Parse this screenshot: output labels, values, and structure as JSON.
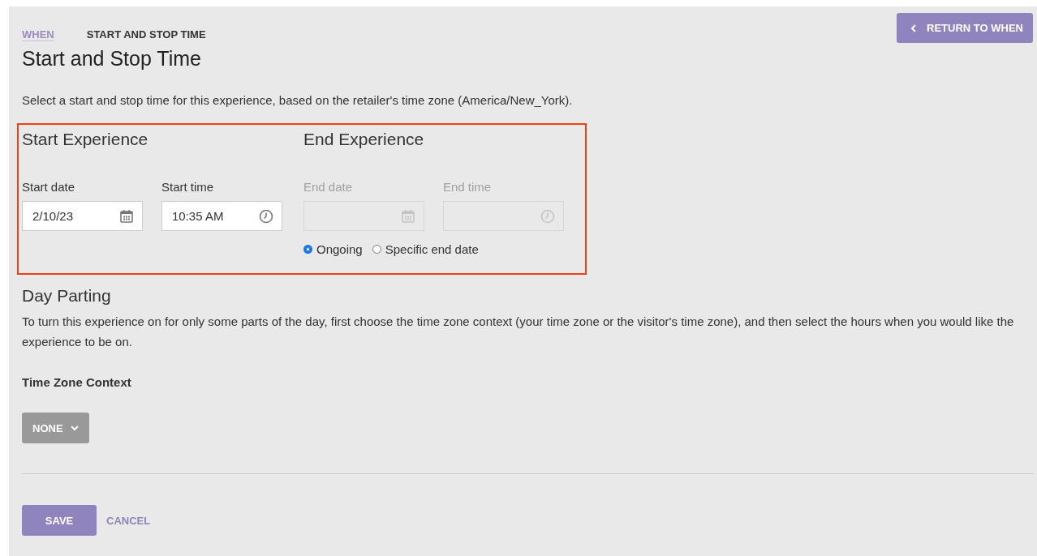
{
  "breadcrumb": [
    {
      "label": "WHEN",
      "kind": "link"
    },
    {
      "label": "START AND STOP TIME",
      "kind": "current"
    }
  ],
  "return_button": {
    "label": "RETURN TO WHEN"
  },
  "title": "Start and Stop Time",
  "description": "Select a start and stop time for this experience, based on the retailer's time zone (America/New_York).",
  "start": {
    "heading": "Start Experience",
    "fields": [
      {
        "label": "Start date",
        "value": "2/10/23",
        "kind": "date",
        "disabled": false
      },
      {
        "label": "Start time",
        "value": "10:35 AM",
        "kind": "time",
        "disabled": false
      }
    ]
  },
  "end": {
    "heading": "End Experience",
    "fields": [
      {
        "label": "End date",
        "kind": "date",
        "disabled": true
      },
      {
        "label": "End time",
        "kind": "time",
        "disabled": true
      }
    ],
    "options": [
      {
        "label": "Ongoing",
        "selected": true
      },
      {
        "label": "Specific end date",
        "selected": false
      }
    ]
  },
  "day_parting": {
    "heading": "Day Parting",
    "description": "To turn this experience on for only some parts of the day, first choose the time zone context (your time zone or the visitor's time zone), and then select the hours when you would like the experience to be on.",
    "context_label": "Time Zone Context",
    "dropdown": {
      "label": "NONE"
    }
  },
  "actions": [
    {
      "label": "SAVE",
      "kind": "primary"
    },
    {
      "label": "CANCEL",
      "kind": "link"
    }
  ]
}
